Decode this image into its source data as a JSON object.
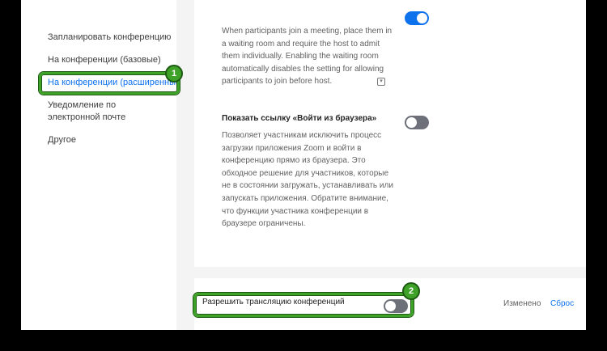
{
  "sidebar": {
    "items": [
      {
        "label": "Запланировать конференцию"
      },
      {
        "label": "На конференции (базовые)"
      },
      {
        "label": "На конференции (расширенные)"
      },
      {
        "label": "Уведомление по электронной почте"
      },
      {
        "label": "Другое"
      }
    ]
  },
  "waiting_room": {
    "description": "When participants join a meeting, place them in a waiting room and require the host to admit them individually. Enabling the waiting room automatically disables the setting for allowing participants to join before host.",
    "enabled": true
  },
  "browser_link": {
    "title": "Показать ссылку «Войти из браузера»",
    "description": "Позволяет участникам исключить процесс загрузки приложения Zoom и войти в конференцию прямо из браузера. Это обходное решение для участников, которые не в состоянии загружать, устанавливать или запускать приложения. Обратите внимание, что функции участника конференции в браузере ограничены.",
    "enabled": false
  },
  "streaming": {
    "title": "Разрешить трансляцию конференций",
    "enabled": false,
    "status": "Изменено",
    "reset": "Сброс"
  },
  "annotations": {
    "badge1": "1",
    "badge2": "2",
    "accent_color": "#3fa228"
  },
  "colors": {
    "link": "#0e72ed",
    "toggle_off": "#6e7079",
    "toggle_on": "#0e72ed"
  }
}
